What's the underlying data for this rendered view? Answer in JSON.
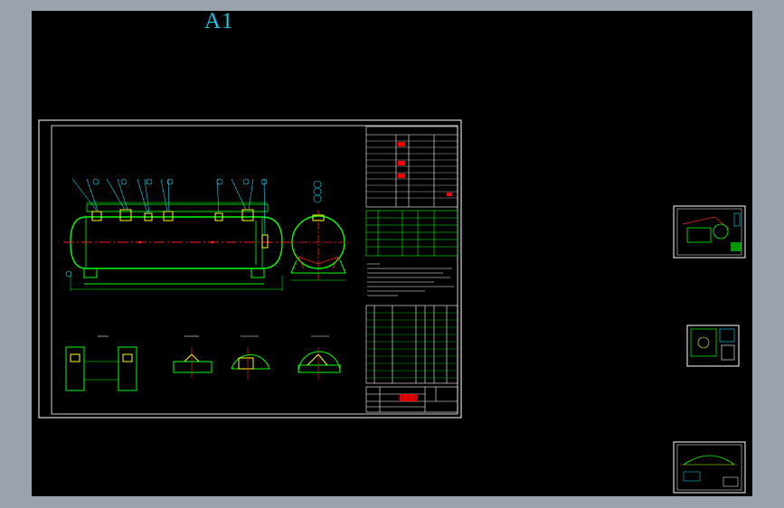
{
  "drawing": {
    "sheet_label": "A1",
    "colors": {
      "background": "#000000",
      "frame": "#ffffff",
      "vessel": "#00ff00",
      "centerline": "#ff2020",
      "nozzle": "#ffff00",
      "leader": "#00e0ff",
      "annotation": "#ffffff",
      "table_header": "#00ff00",
      "highlight": "#ff0000",
      "sheet_label": "#19c9e6"
    },
    "views": [
      "main-elevation-view",
      "end-view",
      "detail-view-1",
      "detail-view-2",
      "detail-view-3",
      "detail-view-4"
    ],
    "thumbnails": [
      "thumbnail-1",
      "thumbnail-2",
      "thumbnail-3"
    ]
  }
}
